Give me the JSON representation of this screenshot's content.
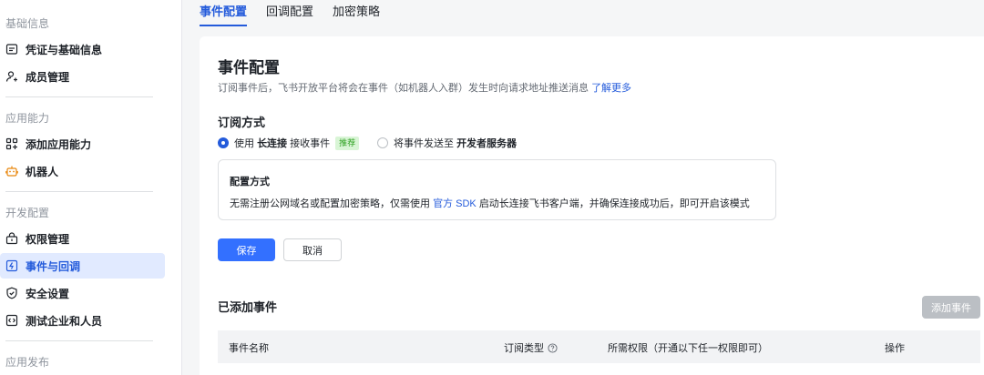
{
  "sidebar": {
    "sections": [
      {
        "title": "基础信息",
        "items": [
          {
            "label": "凭证与基础信息",
            "icon": "credential-icon"
          },
          {
            "label": "成员管理",
            "icon": "member-icon"
          }
        ]
      },
      {
        "title": "应用能力",
        "items": [
          {
            "label": "添加应用能力",
            "icon": "add-capability-icon"
          },
          {
            "label": "机器人",
            "icon": "robot-icon"
          }
        ]
      },
      {
        "title": "开发配置",
        "items": [
          {
            "label": "权限管理",
            "icon": "permission-icon"
          },
          {
            "label": "事件与回调",
            "icon": "event-callback-icon",
            "active": true
          },
          {
            "label": "安全设置",
            "icon": "shield-icon"
          },
          {
            "label": "测试企业和人员",
            "icon": "code-icon"
          }
        ]
      },
      {
        "title": "应用发布",
        "items": []
      }
    ]
  },
  "tabs": [
    {
      "label": "事件配置",
      "active": true
    },
    {
      "label": "回调配置"
    },
    {
      "label": "加密策略"
    }
  ],
  "main": {
    "title": "事件配置",
    "description": "订阅事件后，飞书开放平台将会在事件（如机器人入群）发生时向请求地址推送消息",
    "learn_more": "了解更多",
    "subscription": {
      "title": "订阅方式",
      "option1": {
        "prefix": "使用",
        "bold": "长连接",
        "suffix": "接收事件",
        "tag": "推荐",
        "checked": true
      },
      "option2": {
        "prefix": "将事件发送至",
        "bold": "开发者服务器",
        "checked": false
      }
    },
    "config_box": {
      "title": "配置方式",
      "desc_before": "无需注册公网域名或配置加密策略，仅需使用",
      "desc_link": "官方 SDK",
      "desc_after": "启动长连接飞书客户端，并确保连接成功后，即可开启该模式"
    },
    "buttons": {
      "save": "保存",
      "cancel": "取消"
    },
    "added_events": {
      "title": "已添加事件",
      "add_button": "添加事件",
      "columns": [
        "事件名称",
        "订阅类型",
        "所需权限（开通以下任一权限即可）",
        "操作"
      ]
    }
  },
  "colors": {
    "accent": "#245bdb",
    "primary_button": "#3370ff",
    "active_bg": "#e1eaff",
    "tag_green": "#2ea121"
  }
}
